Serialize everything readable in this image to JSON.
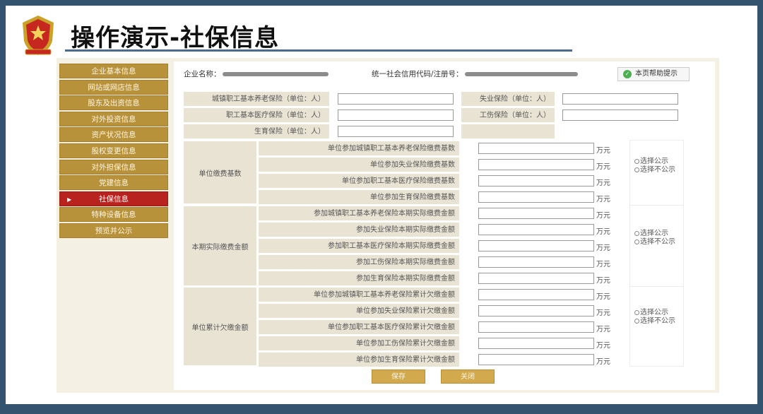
{
  "title": "操作演示-社保信息",
  "nav": [
    {
      "label": "企业基本信息",
      "active": false
    },
    {
      "label": "网站或网店信息",
      "active": false
    },
    {
      "label": "股东及出资信息",
      "active": false
    },
    {
      "label": "对外投资信息",
      "active": false
    },
    {
      "label": "资产状况信息",
      "active": false
    },
    {
      "label": "股权变更信息",
      "active": false
    },
    {
      "label": "对外担保信息",
      "active": false
    },
    {
      "label": "党建信息",
      "active": false
    },
    {
      "label": "社保信息",
      "active": true
    },
    {
      "label": "特种设备信息",
      "active": false
    },
    {
      "label": "预览并公示",
      "active": false
    }
  ],
  "header": {
    "company_label": "企业名称：",
    "credit_label": "统一社会信用代码/注册号：",
    "help": "本页帮助提示"
  },
  "top_fields": {
    "pension": "城镇职工基本养老保险（单位：人）",
    "unemployment": "失业保险（单位：人）",
    "medical": "职工基本医疗保险（单位：人）",
    "injury": "工伤保险（单位：人）",
    "maternity": "生育保险（单位：人）"
  },
  "groups": {
    "base": {
      "label": "单位缴费基数",
      "rows": [
        "单位参加城镇职工基本养老保险缴费基数",
        "单位参加失业保险缴费基数",
        "单位参加职工基本医疗保险缴费基数",
        "单位参加生育保险缴费基数"
      ]
    },
    "actual": {
      "label": "本期实际缴费金额",
      "rows": [
        "参加城镇职工基本养老保险本期实际缴费金额",
        "参加失业保险本期实际缴费金额",
        "参加职工基本医疗保险本期实际缴费金额",
        "参加工伤保险本期实际缴费金额",
        "参加生育保险本期实际缴费金额"
      ]
    },
    "arrears": {
      "label": "单位累计欠缴金额",
      "rows": [
        "单位参加城镇职工基本养老保险累计欠缴金额",
        "单位参加失业保险累计欠缴金额",
        "单位参加职工基本医疗保险累计欠缴金额",
        "单位参加工伤保险累计欠缴金额",
        "单位参加生育保险累计欠缴金额"
      ]
    }
  },
  "unit": "万元",
  "radio": {
    "public": "选择公示",
    "private": "选择不公示"
  },
  "buttons": {
    "save": "保存",
    "close": "关闭"
  },
  "colors": {
    "nav": "#b8923b",
    "nav_active": "#b9231f",
    "frame": "#34536f",
    "button": "#d2a94d"
  }
}
